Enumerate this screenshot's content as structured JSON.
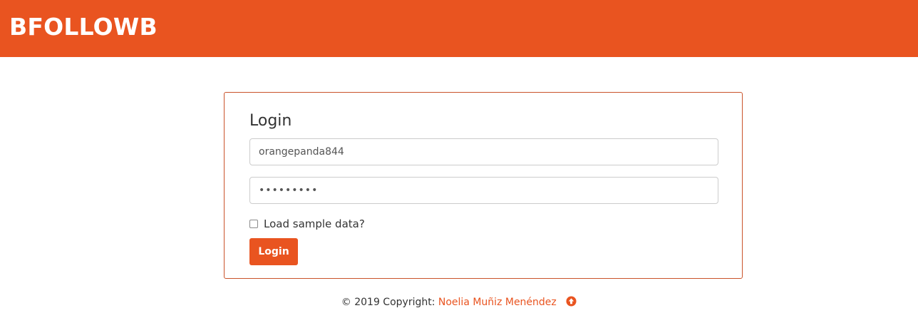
{
  "header": {
    "brand": "BFOLLOWB",
    "color": "#e95420"
  },
  "login_card": {
    "title": "Login",
    "username_value": "orangepanda844",
    "password_value": "•••••••••",
    "checkbox_label": "Load sample data?",
    "checkbox_checked": false,
    "submit_label": "Login",
    "border_color": "#c9532a"
  },
  "footer": {
    "copyright_text": "© 2019 Copyright:",
    "author": "Noelia Muñiz Menéndez",
    "icon": "arrow-up-circle-icon"
  }
}
